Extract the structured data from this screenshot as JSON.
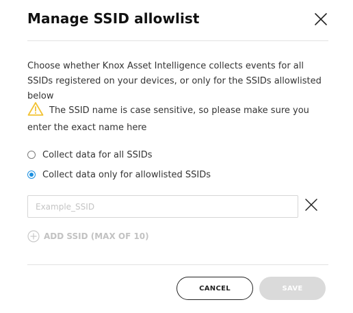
{
  "dialog": {
    "title": "Manage SSID allowlist",
    "description": "Choose whether Knox Asset Intelligence collects events for all SSIDs registered on your devices, or only for the SSIDs allowlisted below",
    "warning": "The SSID name is case sensitive, so please make sure you enter the exact name here",
    "options": [
      {
        "label": "Collect data for all SSIDs",
        "selected": false
      },
      {
        "label": "Collect data only for allowlisted SSIDs",
        "selected": true
      }
    ],
    "ssid_input": {
      "value": "",
      "placeholder": "Example_SSID"
    },
    "add_ssid_label": "ADD SSID (MAX OF 10)",
    "cancel_label": "CANCEL",
    "save_label": "SAVE"
  },
  "colors": {
    "accent": "#1a8fe0",
    "warning": "#f2c233",
    "disabled": "#dadada",
    "disabled_text": "#c2c2c2"
  }
}
